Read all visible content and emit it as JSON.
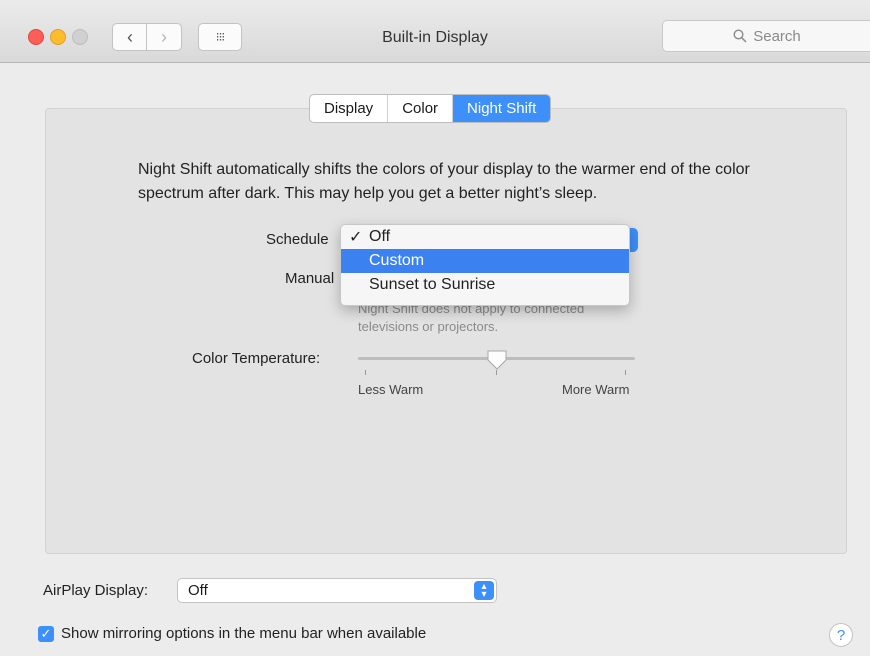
{
  "window": {
    "title": "Built-in Display"
  },
  "toolbar": {
    "back_glyph": "‹",
    "forward_glyph": "›",
    "grid_glyph": "⁝⁝⁝",
    "search_placeholder": "Search",
    "search_icon": "magnifier-icon"
  },
  "tabs": [
    {
      "label": "Display"
    },
    {
      "label": "Color"
    },
    {
      "label": "Night Shift",
      "active": true
    }
  ],
  "night_shift": {
    "description": "Night Shift automatically shifts the colors of your display to the warmer end of the color spectrum after dark. This may help you get a better night’s sleep.",
    "schedule_label": "Schedule",
    "manual_label": "Manual",
    "schedule_menu": {
      "items": [
        {
          "label": "Off",
          "checked": true
        },
        {
          "label": "Custom",
          "highlighted": true
        },
        {
          "label": "Sunset to Sunrise"
        }
      ],
      "check_glyph": "✓"
    },
    "note": "Night Shift does not apply to connected televisions or projectors.",
    "color_temperature": {
      "label": "Color Temperature:",
      "min_label": "Less Warm",
      "max_label": "More Warm",
      "value_fraction": 0.5
    }
  },
  "airplay": {
    "label": "AirPlay Display:",
    "value": "Off"
  },
  "mirroring": {
    "label": "Show mirroring options in the menu bar when available",
    "checked": true
  },
  "help": {
    "glyph": "?"
  },
  "colors": {
    "accent": "#3d8ffa",
    "close": "#fc5f57",
    "minimize": "#fdbc2e"
  }
}
